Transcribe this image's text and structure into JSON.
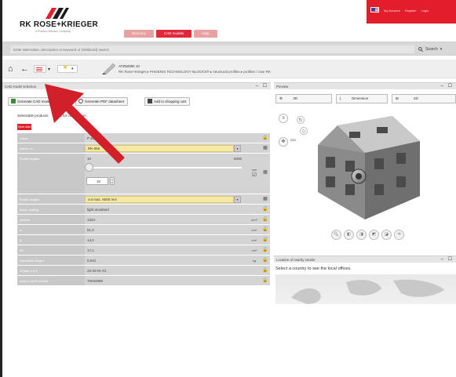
{
  "header": {
    "logo": "RK ROSE+KRIEGER",
    "logo_sub": "A Phoenix Mecano Company",
    "nav_tabs": [
      "Directory",
      "CAD models",
      "Help"
    ],
    "topbar_links": [
      "My Account",
      "Register",
      "Login"
    ]
  },
  "search": {
    "placeholder": "Enter alternative, description or keyword or (Wildcard) search",
    "button_label": "Search"
  },
  "toolbar": {
    "part_title": "ATZ50090 10",
    "breadcrumb": "RK Rose+Krieger  ▸  PHOENIX TECHNOLOGY BLOCKS®  ▸  structural profiles  ▸  profiles / rose RK"
  },
  "left_panel": {
    "title": "CAD model selection",
    "buttons": {
      "generate_cad": "Generate CAD model",
      "generate_pdf": "Generate PDF datasheet",
      "add_cart": "Add to shopping cart"
    },
    "selectable_products": "Selectable products",
    "add_comparison": "Add for comparison",
    "more_label": "More data",
    "rows": [
      {
        "label": "Article",
        "value": "P 40x40",
        "unit": "",
        "lock": "🔒"
      },
      {
        "label": "Article no.",
        "value": "RK-050",
        "unit": "",
        "lock": "▦"
      },
      {
        "label": "Profile lengths",
        "value": "10",
        "max": "6000",
        "unit": "mm",
        "lock": "▦",
        "input": "10"
      },
      {
        "label": "Profile lengths",
        "value": "cut max. 6000 mm",
        "unit": "",
        "lock": "▦"
      },
      {
        "label": "anod. coating",
        "value": "light anodised",
        "unit": "",
        "lock": "🔒"
      },
      {
        "label": "surface",
        "value": "1324",
        "unit": "mm²",
        "lock": "🔒"
      },
      {
        "label": "Ix",
        "value": "51,2",
        "unit": "cm⁴",
        "lock": "🔒"
      },
      {
        "label": "Iy",
        "value": "14,0",
        "unit": "cm⁴",
        "lock": "🔒"
      },
      {
        "label": "Wt",
        "value": "17,1",
        "unit": "cm³",
        "lock": "🔒"
      },
      {
        "label": "calculated weight",
        "value": "0,041",
        "unit": "kg",
        "lock": "🔒"
      },
      {
        "label": "eClass V 5.0",
        "value": "23-30-01-01",
        "unit": "",
        "lock": "🔒"
      },
      {
        "label": "custom tariff number",
        "value": "76042990",
        "unit": "",
        "lock": "🔒"
      }
    ]
  },
  "right_panel": {
    "title": "Preview",
    "view_buttons": [
      "3D",
      "Dimension",
      "2D"
    ],
    "location_title": "Location of nearby vendor",
    "location_text": "Select a country to see the local offices."
  },
  "colors": {
    "brand_red": "#e31e2c",
    "field_yellow": "#f5e9a4"
  }
}
